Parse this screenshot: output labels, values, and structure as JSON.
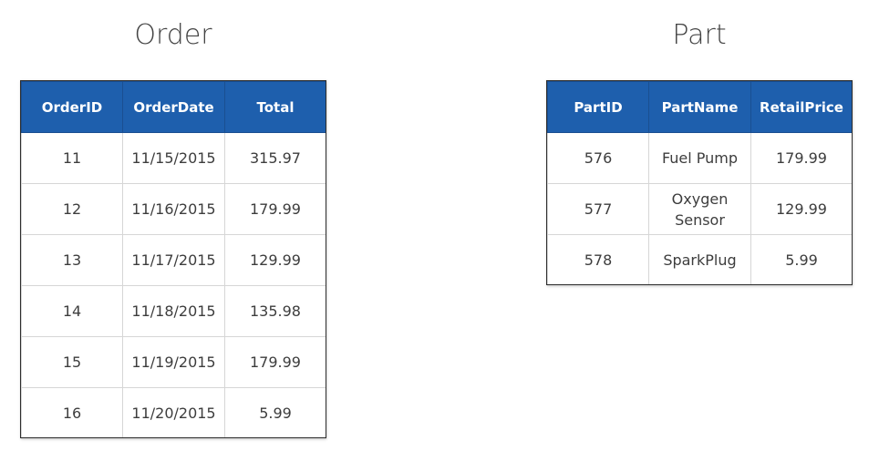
{
  "order": {
    "title": "Order",
    "headers": [
      "OrderID",
      "OrderDate",
      "Total"
    ],
    "rows": [
      [
        "11",
        "11/15/2015",
        "315.97"
      ],
      [
        "12",
        "11/16/2015",
        "179.99"
      ],
      [
        "13",
        "11/17/2015",
        "129.99"
      ],
      [
        "14",
        "11/18/2015",
        "135.98"
      ],
      [
        "15",
        "11/19/2015",
        "179.99"
      ],
      [
        "16",
        "11/20/2015",
        "5.99"
      ]
    ]
  },
  "part": {
    "title": "Part",
    "headers": [
      "PartID",
      "PartName",
      "RetailPrice"
    ],
    "rows": [
      [
        "576",
        "Fuel Pump",
        "179.99"
      ],
      [
        "577",
        "Oxygen Sensor",
        "129.99"
      ],
      [
        "578",
        "SparkPlug",
        "5.99"
      ]
    ]
  },
  "colors": {
    "header_bg": "#1e5fad",
    "header_text": "#ffffff",
    "cell_text": "#3d3d3d",
    "grid": "#d6d6d6"
  }
}
